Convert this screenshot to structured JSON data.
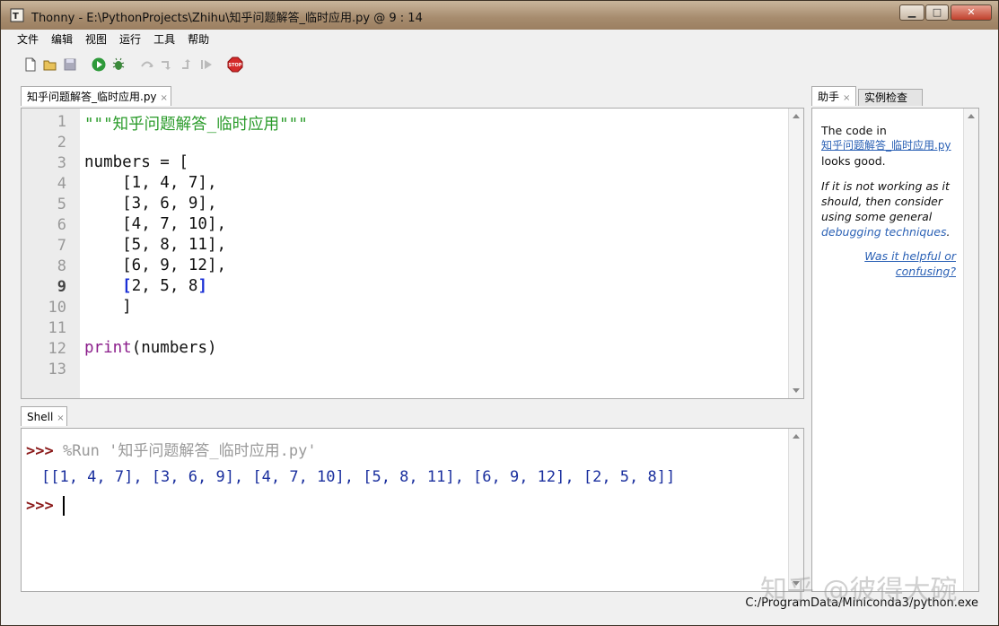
{
  "window": {
    "title": "Thonny  -  E:\\PythonProjects\\Zhihu\\知乎问题解答_临时应用.py  @  9 : 14",
    "minimize_label": "▁",
    "maximize_label": "□",
    "close_label": "✕"
  },
  "menu": {
    "items": [
      "文件",
      "编辑",
      "视图",
      "运行",
      "工具",
      "帮助"
    ]
  },
  "toolbar": {
    "buttons": [
      "new-file",
      "open-file",
      "save-file",
      "run",
      "debug",
      "step-over",
      "step-into",
      "step-out",
      "resume",
      "stop"
    ],
    "stop_label": "STOP"
  },
  "editor": {
    "tab_label": "知乎问题解答_临时应用.py",
    "tab_close": "×",
    "line_numbers": [
      "1",
      "2",
      "3",
      "4",
      "5",
      "6",
      "7",
      "8",
      "9",
      "10",
      "11",
      "12",
      "13"
    ],
    "lines": [
      "\"\"\"知乎问题解答_临时应用\"\"\"",
      "",
      "numbers = [",
      "    [1, 4, 7],",
      "    [3, 6, 9],",
      "    [4, 7, 10],",
      "    [5, 8, 11],",
      "    [6, 9, 12],",
      "    [2, 5, 8]",
      "    ]",
      "",
      "print(numbers)",
      ""
    ],
    "line9": {
      "open": "[",
      "middle": "2, 5, 8",
      "close": "]"
    },
    "line12": {
      "kw": "print",
      "rest": "(numbers)"
    }
  },
  "shell": {
    "tab_label": "Shell",
    "tab_close": "×",
    "prompt": ">>>",
    "run_command": "%Run '知乎问题解答_临时应用.py'",
    "output": "[[1, 4, 7], [3, 6, 9], [4, 7, 10], [5, 8, 11], [6, 9, 12], [2, 5, 8]]"
  },
  "assistant": {
    "tab_help": "助手",
    "tab_close": "×",
    "tab_inspect": "实例检查",
    "msg1": "The code in",
    "msg1_link": "知乎问题解答_临时应用.py",
    "msg1_end": "looks good.",
    "msg2": "If it is not working as it should, then consider using some general",
    "msg2_link": "debugging techniques",
    "msg2_end": ".",
    "feedback": "Was it helpful or confusing?"
  },
  "status": {
    "interpreter": "C:/ProgramData/Miniconda3/python.exe"
  },
  "watermark": "知乎 @彼得大碗"
}
